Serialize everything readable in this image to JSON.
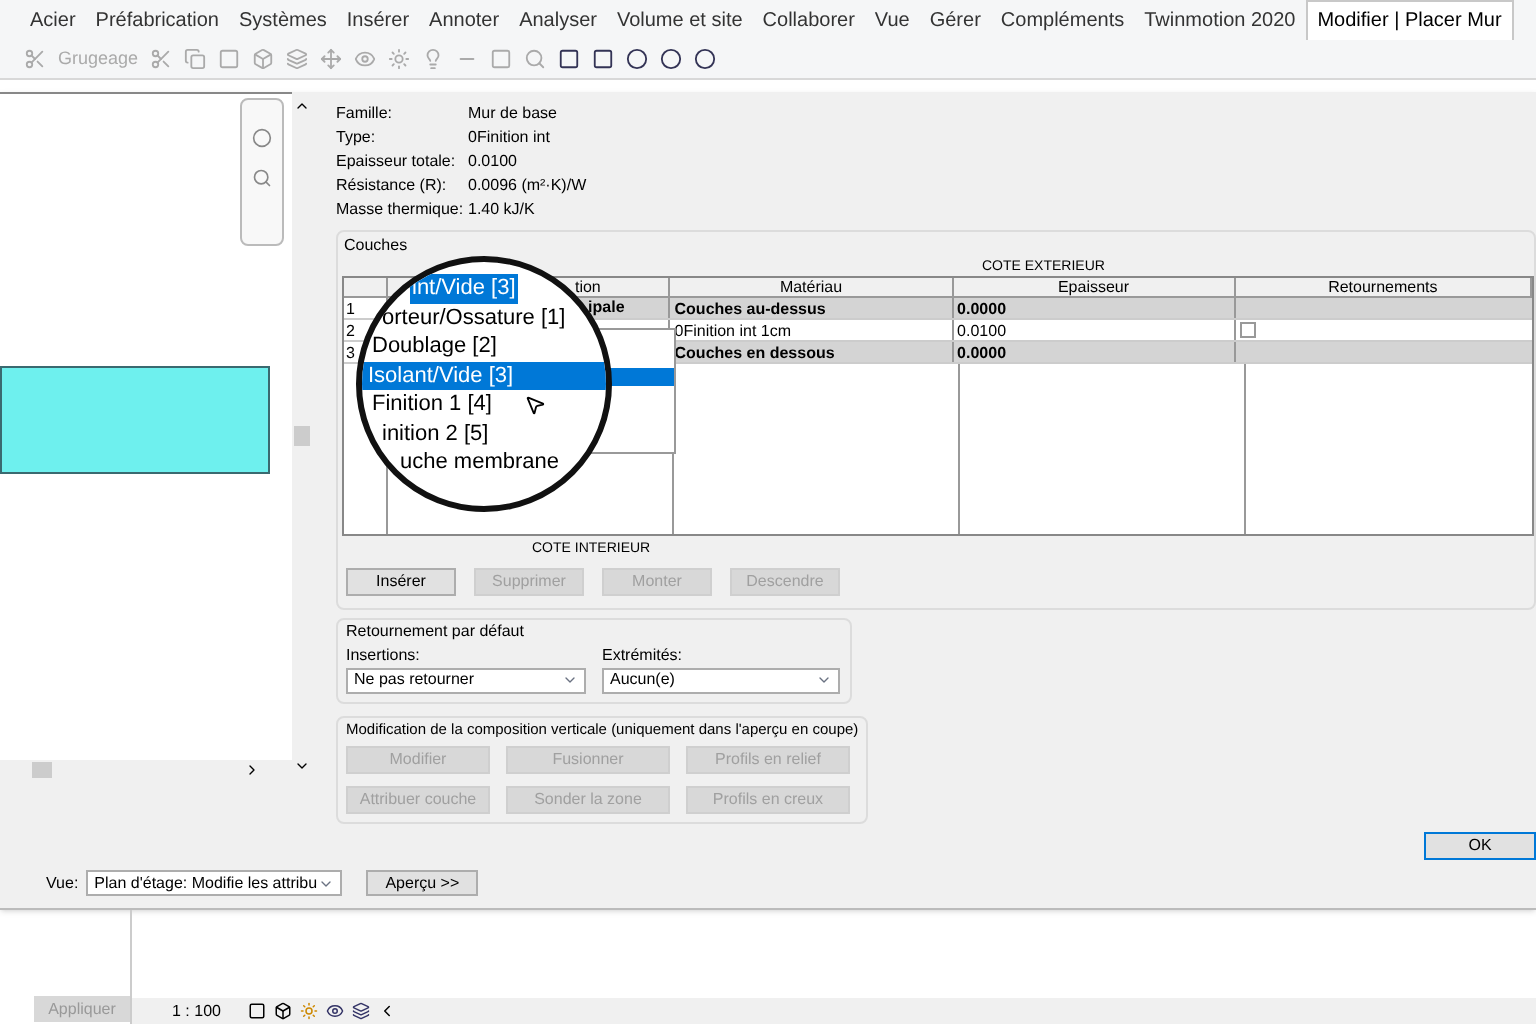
{
  "ribbon": {
    "tabs": [
      {
        "label": "Acier",
        "selected": false
      },
      {
        "label": "Préfabrication",
        "selected": false
      },
      {
        "label": "Systèmes",
        "selected": false
      },
      {
        "label": "Insérer",
        "selected": false
      },
      {
        "label": "Annoter",
        "selected": false
      },
      {
        "label": "Analyser",
        "selected": false
      },
      {
        "label": "Volume et site",
        "selected": false
      },
      {
        "label": "Collaborer",
        "selected": false
      },
      {
        "label": "Vue",
        "selected": false
      },
      {
        "label": "Gérer",
        "selected": false
      },
      {
        "label": "Compléments",
        "selected": false
      },
      {
        "label": "Twinmotion 2020",
        "selected": false
      },
      {
        "label": "Modifier | Placer Mur",
        "selected": true
      }
    ],
    "toolbar_label": "Grugeage"
  },
  "properties": [
    {
      "label": "Famille:",
      "value": "Mur de base"
    },
    {
      "label": "Type:",
      "value": "0Finition int"
    },
    {
      "label": "Epaisseur totale:",
      "value": "0.0100"
    },
    {
      "label": "Résistance (R):",
      "value": "0.0096 (m²·K)/W"
    },
    {
      "label": "Masse thermique:",
      "value": "1.40 kJ/K"
    }
  ],
  "layers": {
    "title": "Couches",
    "top_side": "COTE EXTERIEUR",
    "bottom_side": "COTE INTERIEUR",
    "columns": [
      "tion",
      "Matériau",
      "Epaisseur",
      "Retournements"
    ],
    "rows": [
      {
        "number": "1",
        "function": "ipale",
        "material": "Couches au-dessus",
        "thickness": "0.0000",
        "kind": "boundary"
      },
      {
        "number": "2",
        "material": "0Finition int 1cm",
        "thickness": "0.0100",
        "kind": "layer",
        "wraps": false
      },
      {
        "number": "3",
        "material": "Couches en dessous",
        "thickness": "0.0000",
        "kind": "boundary"
      }
    ],
    "buttons": [
      {
        "label": "Insérer",
        "disabled": false
      },
      {
        "label": "Supprimer",
        "disabled": true
      },
      {
        "label": "Monter",
        "disabled": true
      },
      {
        "label": "Descendre",
        "disabled": true
      }
    ]
  },
  "magnifier": {
    "header": "int/Vide [3]",
    "options": [
      {
        "label": "orteur/Ossature [1]",
        "selected": false
      },
      {
        "label": "Doublage [2]",
        "selected": false
      },
      {
        "label": "Isolant/Vide [3]",
        "selected": true
      },
      {
        "label": "Finition 1 [4]",
        "selected": false
      },
      {
        "label": "inition 2 [5]",
        "selected": false
      },
      {
        "label": "uche membrane",
        "selected": false
      }
    ]
  },
  "wrapping": {
    "title": "Retournement par défaut",
    "insertions": {
      "label": "Insertions:",
      "value": "Ne pas retourner"
    },
    "ends": {
      "label": "Extrémités:",
      "value": "Aucun(e)"
    }
  },
  "vertical": {
    "title": "Modification de la composition verticale (uniquement dans l'aperçu en coupe)",
    "buttons": [
      {
        "label": "Modifier",
        "disabled": true
      },
      {
        "label": "Fusionner",
        "disabled": true
      },
      {
        "label": "Profils en relief",
        "disabled": true
      },
      {
        "label": "Attribuer couche",
        "disabled": true
      },
      {
        "label": "Sonder la zone",
        "disabled": true
      },
      {
        "label": "Profils en creux",
        "disabled": true
      }
    ]
  },
  "footer": {
    "view_label": "Vue:",
    "view_value": "Plan d'étage: Modifie les attribu",
    "preview_button": "Aperçu >>",
    "ok_button": "OK"
  },
  "status_bar": {
    "apply_button": "Appliquer",
    "scale": "1 : 100"
  }
}
